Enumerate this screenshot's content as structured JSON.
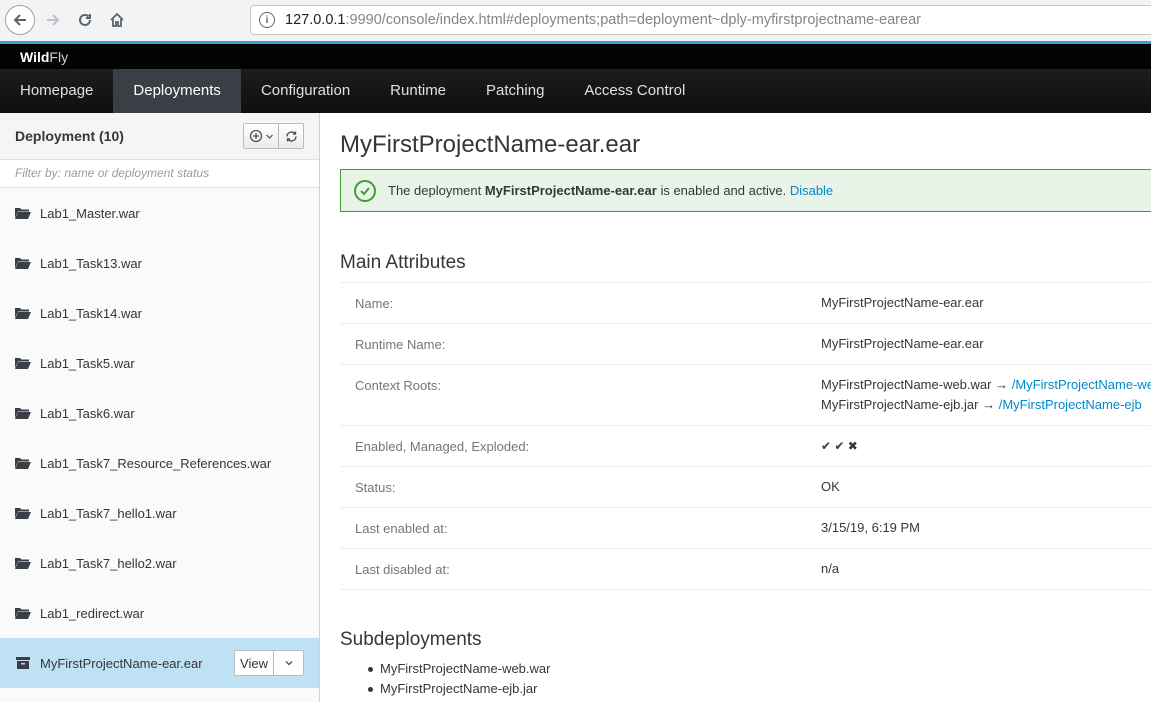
{
  "browser": {
    "url_host": "127.0.0.1",
    "url_rest": ":9990/console/index.html#deployments;path=deployment~dply-myfirstprojectname-earear",
    "icons": [
      "back-icon",
      "forward-icon",
      "reload-icon",
      "home-icon",
      "info-icon"
    ]
  },
  "brand": {
    "wild": "Wild",
    "fly": "Fly"
  },
  "topnav": [
    {
      "label": "Homepage"
    },
    {
      "label": "Deployments"
    },
    {
      "label": "Configuration"
    },
    {
      "label": "Runtime"
    },
    {
      "label": "Patching"
    },
    {
      "label": "Access Control"
    }
  ],
  "sidebar": {
    "title": "Deployment (10)",
    "filter_placeholder": "Filter by: name or deployment status",
    "items": [
      {
        "label": "Lab1_Master.war"
      },
      {
        "label": "Lab1_Task13.war"
      },
      {
        "label": "Lab1_Task14.war"
      },
      {
        "label": "Lab1_Task5.war"
      },
      {
        "label": "Lab1_Task6.war"
      },
      {
        "label": "Lab1_Task7_Resource_References.war"
      },
      {
        "label": "Lab1_Task7_hello1.war"
      },
      {
        "label": "Lab1_Task7_hello2.war"
      },
      {
        "label": "Lab1_redirect.war"
      },
      {
        "label": "MyFirstProjectName-ear.ear"
      }
    ],
    "selected_view_label": "View"
  },
  "main": {
    "title": "MyFirstProjectName-ear.ear",
    "alert": {
      "prefix": "The deployment ",
      "name": "MyFirstProjectName-ear.ear",
      "suffix": " is enabled and active. ",
      "link": "Disable"
    },
    "main_attributes_title": "Main Attributes",
    "attributes": {
      "name_label": "Name:",
      "name_value": "MyFirstProjectName-ear.ear",
      "runtime_label": "Runtime Name:",
      "runtime_value": "MyFirstProjectName-ear.ear",
      "context_label": "Context Roots:",
      "context_1_module": "MyFirstProjectName-web.war",
      "context_1_link": "/MyFirstProjectName-web",
      "context_2_module": "MyFirstProjectName-ejb.jar",
      "context_2_link": "/MyFirstProjectName-ejb",
      "arrow": "→",
      "flags_label": "Enabled, Managed, Exploded:",
      "flags_value": "✔ ✔ ✖",
      "status_label": "Status:",
      "status_value": "OK",
      "enabled_label": "Last enabled at:",
      "enabled_value": "3/15/19, 6:19 PM",
      "disabled_label": "Last disabled at:",
      "disabled_value": "n/a"
    },
    "subdeployments_title": "Subdeployments",
    "subdeployments": [
      {
        "label": "MyFirstProjectName-web.war"
      },
      {
        "label": "MyFirstProjectName-ejb.jar"
      }
    ]
  },
  "colors": {
    "accent": "#0088ce",
    "success": "#3f9c35",
    "selected_row": "#bee1f4",
    "nav_active": "#393f44"
  }
}
